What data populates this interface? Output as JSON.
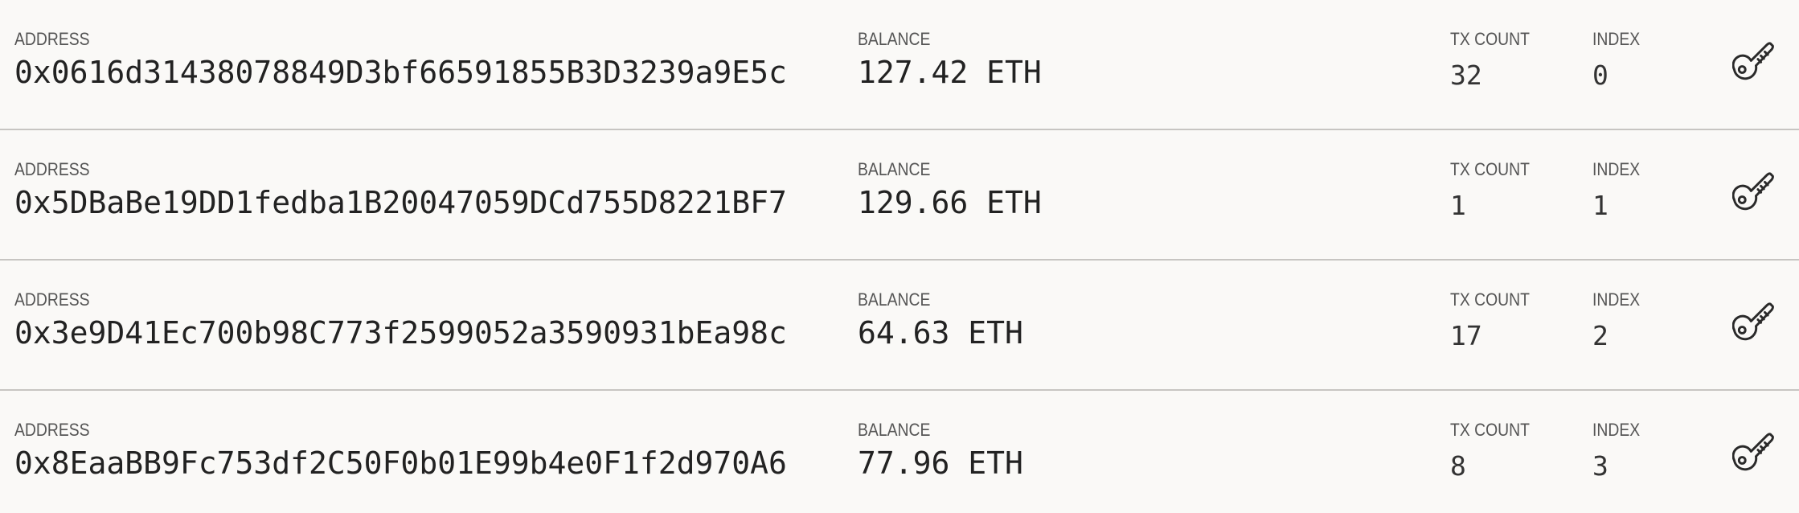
{
  "accounts": [
    {
      "address_label": "ADDRESS",
      "address": "0x0616d31438078849D3bf66591855B3D3239a9E5c",
      "balance_label": "BALANCE",
      "balance": "127.42 ETH",
      "tx_count_label": "TX COUNT",
      "tx_count": "32",
      "index_label": "INDEX",
      "index": "0",
      "action_icon": "key-icon"
    },
    {
      "address_label": "ADDRESS",
      "address": "0x5DBaBe19DD1fedba1B20047059DCd755D8221BF7",
      "balance_label": "BALANCE",
      "balance": "129.66 ETH",
      "tx_count_label": "TX COUNT",
      "tx_count": "1",
      "index_label": "INDEX",
      "index": "1",
      "action_icon": "key-icon"
    },
    {
      "address_label": "ADDRESS",
      "address": "0x3e9D41Ec700b98C773f2599052a3590931bEa98c",
      "balance_label": "BALANCE",
      "balance": "64.63 ETH",
      "tx_count_label": "TX COUNT",
      "tx_count": "17",
      "index_label": "INDEX",
      "index": "2",
      "action_icon": "key-icon"
    },
    {
      "address_label": "ADDRESS",
      "address": "0x8EaaBB9Fc753df2C50F0b01E99b4e0F1f2d970A6",
      "balance_label": "BALANCE",
      "balance": "77.96 ETH",
      "tx_count_label": "TX COUNT",
      "tx_count": "8",
      "index_label": "INDEX",
      "index": "3",
      "action_icon": "key-icon"
    }
  ],
  "colors": {
    "background": "#faf9f7",
    "divider": "#c7c5c2",
    "label_text": "#555555",
    "value_text": "#222222"
  }
}
